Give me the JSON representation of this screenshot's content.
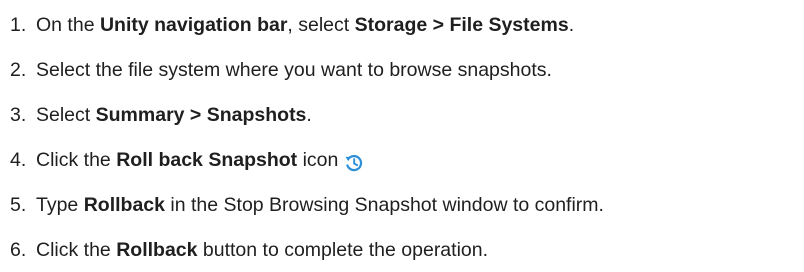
{
  "steps": [
    {
      "number": "1.",
      "parts": [
        {
          "text": "On the ",
          "bold": false
        },
        {
          "text": "Unity navigation bar",
          "bold": true
        },
        {
          "text": ", select ",
          "bold": false
        },
        {
          "text": "Storage > File Systems",
          "bold": true
        },
        {
          "text": ".",
          "bold": false
        }
      ]
    },
    {
      "number": "2.",
      "parts": [
        {
          "text": "Select the file system where you want to browse snapshots.",
          "bold": false
        }
      ]
    },
    {
      "number": "3.",
      "parts": [
        {
          "text": "Select ",
          "bold": false
        },
        {
          "text": "Summary > Snapshots",
          "bold": true
        },
        {
          "text": ".",
          "bold": false
        }
      ]
    },
    {
      "number": "4.",
      "parts": [
        {
          "text": "Click the ",
          "bold": false
        },
        {
          "text": "Roll back Snapshot",
          "bold": true
        },
        {
          "text": " icon",
          "bold": false
        }
      ],
      "icon": "rollback-snapshot-icon"
    },
    {
      "number": "5.",
      "parts": [
        {
          "text": "Type ",
          "bold": false
        },
        {
          "text": "Rollback",
          "bold": true
        },
        {
          "text": " in the Stop Browsing Snapshot window to confirm.",
          "bold": false
        }
      ]
    },
    {
      "number": "6.",
      "parts": [
        {
          "text": "Click the ",
          "bold": false
        },
        {
          "text": "Rollback",
          "bold": true
        },
        {
          "text": " button to complete the operation.",
          "bold": false
        }
      ]
    }
  ],
  "colors": {
    "text": "#1f1f1f",
    "icon": "#2a8fd8"
  }
}
